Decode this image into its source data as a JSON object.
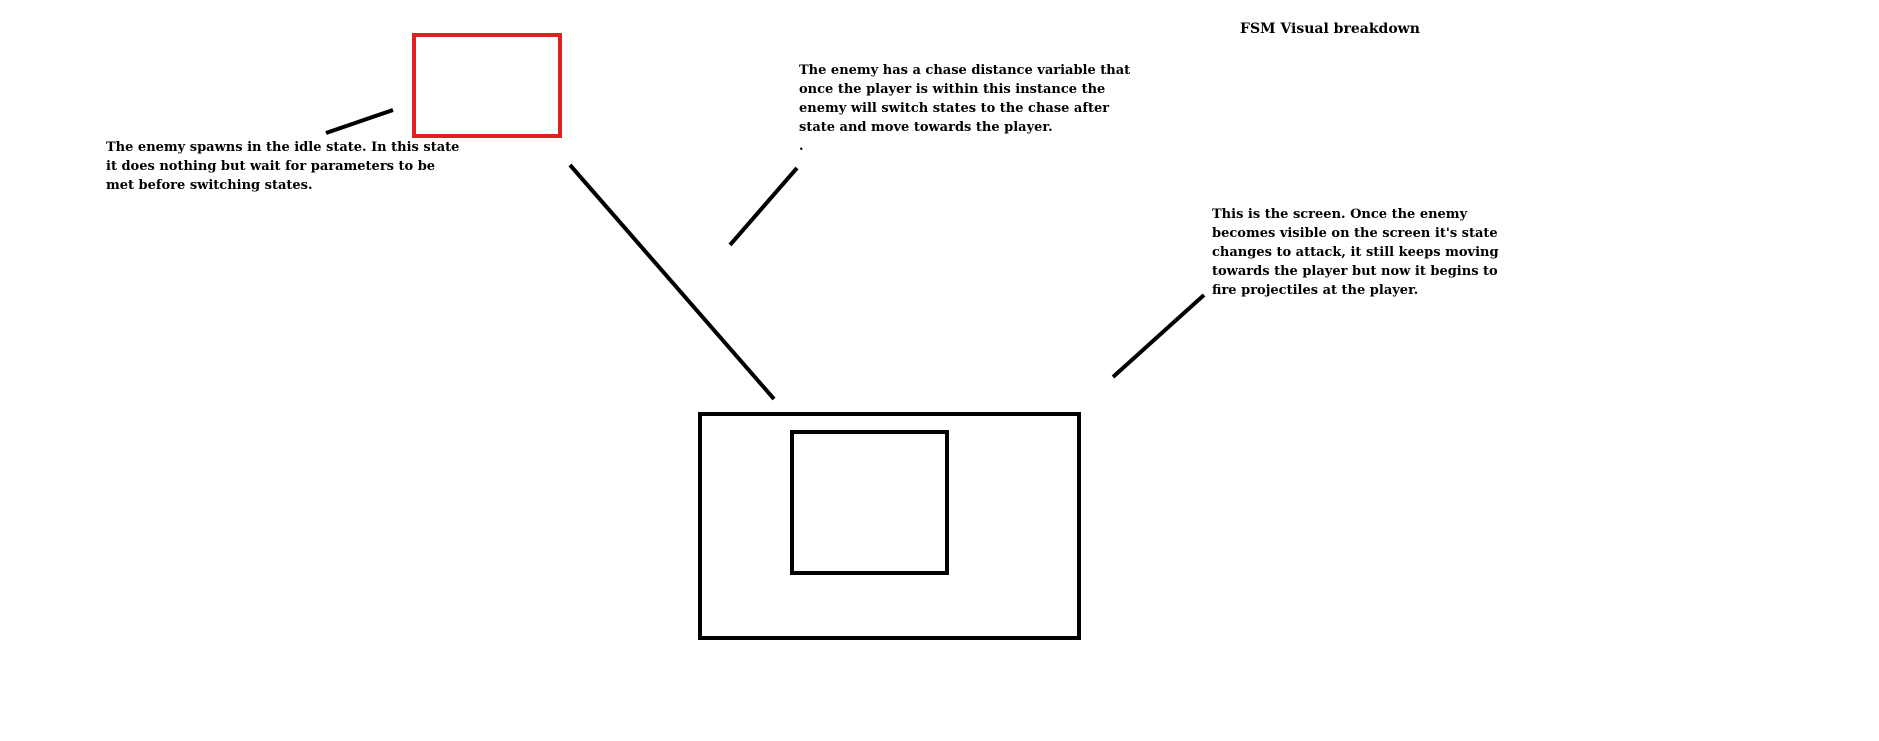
{
  "diagram": {
    "title": "FSM Visual breakdown",
    "colors": {
      "enemy_box": "#e02020",
      "lines": "#000000",
      "background": "#ffffff"
    },
    "annotations": {
      "idle": {
        "lines": [
          "The enemy spawns in the idle state. In this state",
          "it does nothing but wait for parameters to be",
          "met before switching states."
        ]
      },
      "chase": {
        "lines": [
          "The enemy has a chase distance variable that",
          "once the player is within this instance the",
          "enemy will switch states to the chase after",
          "state and move towards the player.",
          "."
        ]
      },
      "attack": {
        "lines": [
          "This is the screen. Once the enemy",
          "becomes visible on the screen it's state",
          "changes to attack, it still keeps moving",
          "towards the player but now it begins to",
          "fire projectiles at the player."
        ]
      }
    }
  }
}
